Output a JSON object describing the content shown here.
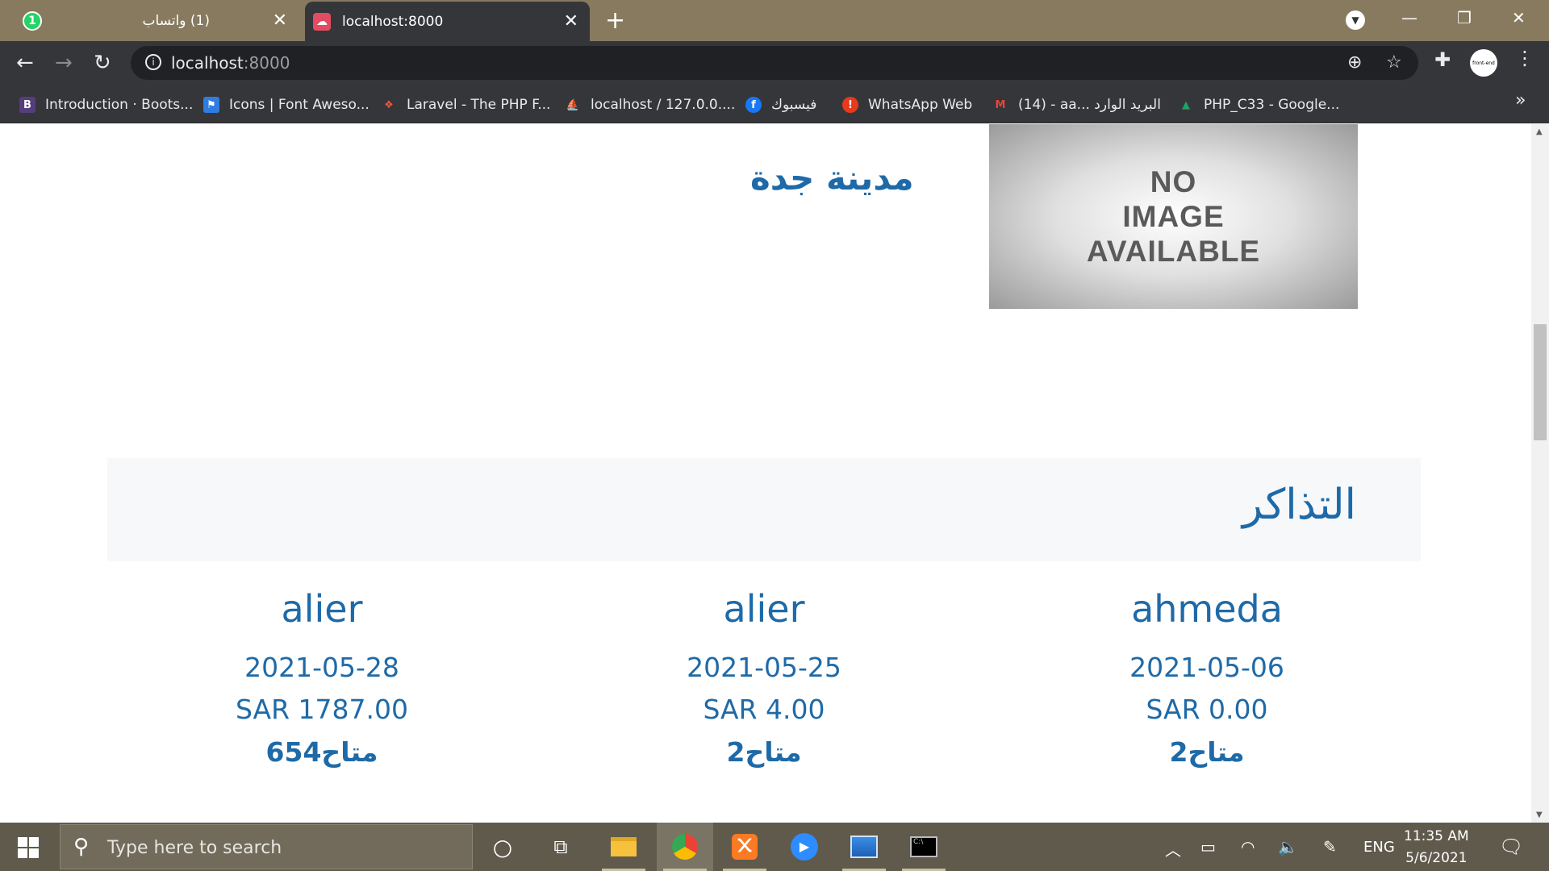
{
  "browser": {
    "tabs": [
      {
        "title": "(1) واتساب",
        "favicon": "whatsapp-icon",
        "badge": "1"
      },
      {
        "title": "localhost:8000",
        "favicon": "laravel-icon"
      }
    ],
    "url": {
      "host": "localhost",
      "port": ":8000"
    },
    "bookmarks": [
      {
        "label": "Introduction · Boots...",
        "icon": "bootstrap-icon",
        "icon_text": "B",
        "color": "#563d7c"
      },
      {
        "label": "Icons | Font Aweso...",
        "icon": "fontawesome-icon",
        "icon_text": "⚑",
        "color": "#2f7de1"
      },
      {
        "label": "Laravel - The PHP F...",
        "icon": "laravel-icon",
        "icon_text": "❖",
        "color": "#f05340"
      },
      {
        "label": "localhost / 127.0.0....",
        "icon": "phpmyadmin-icon",
        "icon_text": "⛵",
        "color": "#f29111"
      },
      {
        "label": "فيسبوك",
        "icon": "facebook-icon",
        "icon_text": "f",
        "color": "#1877f2"
      },
      {
        "label": "WhatsApp Web",
        "icon": "alert-icon",
        "icon_text": "!",
        "color": "#e8391c"
      },
      {
        "label": "(14) - aa... البريد الوارد",
        "icon": "gmail-icon",
        "icon_text": "M",
        "color": "#ea4335"
      },
      {
        "label": "PHP_C33 - Google...",
        "icon": "google-drive-icon",
        "icon_text": "▲",
        "color": "#1fa463"
      }
    ]
  },
  "page": {
    "city_title": "مدينة جدة",
    "noimage": [
      "NO",
      "IMAGE",
      "AVAILABLE"
    ],
    "section_title": "التذاكر",
    "tickets": [
      {
        "name": "ahmeda",
        "date": "2021-05-06",
        "price": "SAR 0.00",
        "available": "متاح2"
      },
      {
        "name": "alier",
        "date": "2021-05-25",
        "price": "SAR 4.00",
        "available": "متاح2"
      },
      {
        "name": "alier",
        "date": "2021-05-28",
        "price": "SAR 1787.00",
        "available": "متاح654"
      }
    ]
  },
  "taskbar": {
    "search_placeholder": "Type here to search",
    "language": "ENG",
    "time": "11:35 AM",
    "date": "5/6/2021"
  },
  "colors": {
    "accent": "#1e6aa8",
    "tab_bar": "#877a5f",
    "taskbar": "#5f5a4c"
  }
}
